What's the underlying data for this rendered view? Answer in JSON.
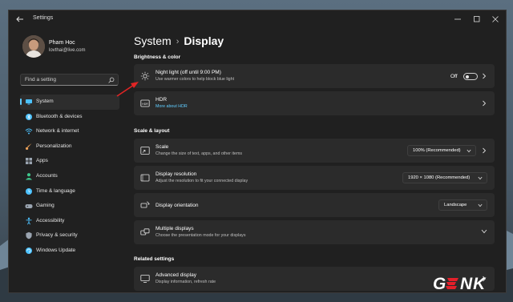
{
  "window": {
    "title": "Settings",
    "controls": {
      "minimize": "–",
      "maximize": "□",
      "close": "✕"
    }
  },
  "profile": {
    "name": "Pham Hoc",
    "email": "lovthai@live.com"
  },
  "search": {
    "placeholder": "Find a setting",
    "icon": "search-icon"
  },
  "nav": {
    "items": [
      {
        "label": "System",
        "icon": "system-icon",
        "color": "#4cc2ff",
        "active": true
      },
      {
        "label": "Bluetooth & devices",
        "icon": "bluetooth-icon",
        "color": "#4cc2ff"
      },
      {
        "label": "Network & internet",
        "icon": "network-icon",
        "color": "#4cc2ff"
      },
      {
        "label": "Personalization",
        "icon": "brush-icon",
        "color": "#f0a35a"
      },
      {
        "label": "Apps",
        "icon": "apps-icon",
        "color": "#9aa4b0"
      },
      {
        "label": "Accounts",
        "icon": "accounts-icon",
        "color": "#3ec48a"
      },
      {
        "label": "Time & language",
        "icon": "globe-clock-icon",
        "color": "#4cc2ff"
      },
      {
        "label": "Gaming",
        "icon": "gamepad-icon",
        "color": "#9aa4b0"
      },
      {
        "label": "Accessibility",
        "icon": "accessibility-icon",
        "color": "#4cc2ff"
      },
      {
        "label": "Privacy & security",
        "icon": "shield-icon",
        "color": "#9aa4b0"
      },
      {
        "label": "Windows Update",
        "icon": "update-icon",
        "color": "#4cc2ff"
      }
    ]
  },
  "breadcrumb": {
    "parent": "System",
    "separator": "›",
    "current": "Display"
  },
  "sections": {
    "brightness": "Brightness & color",
    "scale_layout": "Scale & layout",
    "related": "Related settings"
  },
  "cards": {
    "night_light": {
      "title": "Night light (off until 9:00 PM)",
      "subtitle": "Use warmer colors to help block blue light",
      "toggle_label": "Off",
      "toggle_on": false,
      "icon": "brightness-icon"
    },
    "hdr": {
      "title": "HDR",
      "subtitle": "More about HDR",
      "icon": "hdr-icon"
    },
    "scale": {
      "title": "Scale",
      "subtitle": "Change the size of text, apps, and other items",
      "value": "100% (Recommended)",
      "icon": "scale-icon"
    },
    "resolution": {
      "title": "Display resolution",
      "subtitle": "Adjust the resolution to fit your connected display",
      "value": "1920 × 1080 (Recommended)",
      "icon": "resolution-icon"
    },
    "orientation": {
      "title": "Display orientation",
      "value": "Landscape",
      "icon": "orientation-icon"
    },
    "multiple": {
      "title": "Multiple displays",
      "subtitle": "Choose the presentation mode for your displays",
      "icon": "multiple-displays-icon"
    },
    "advanced": {
      "title": "Advanced display",
      "subtitle": "Display information, refresh rate",
      "icon": "monitor-icon"
    }
  },
  "watermark": {
    "text": "GENK",
    "color": "#e4202a"
  },
  "colors": {
    "accent": "#60cdff",
    "window_bg": "#202020",
    "card_bg": "#2b2b2b"
  }
}
